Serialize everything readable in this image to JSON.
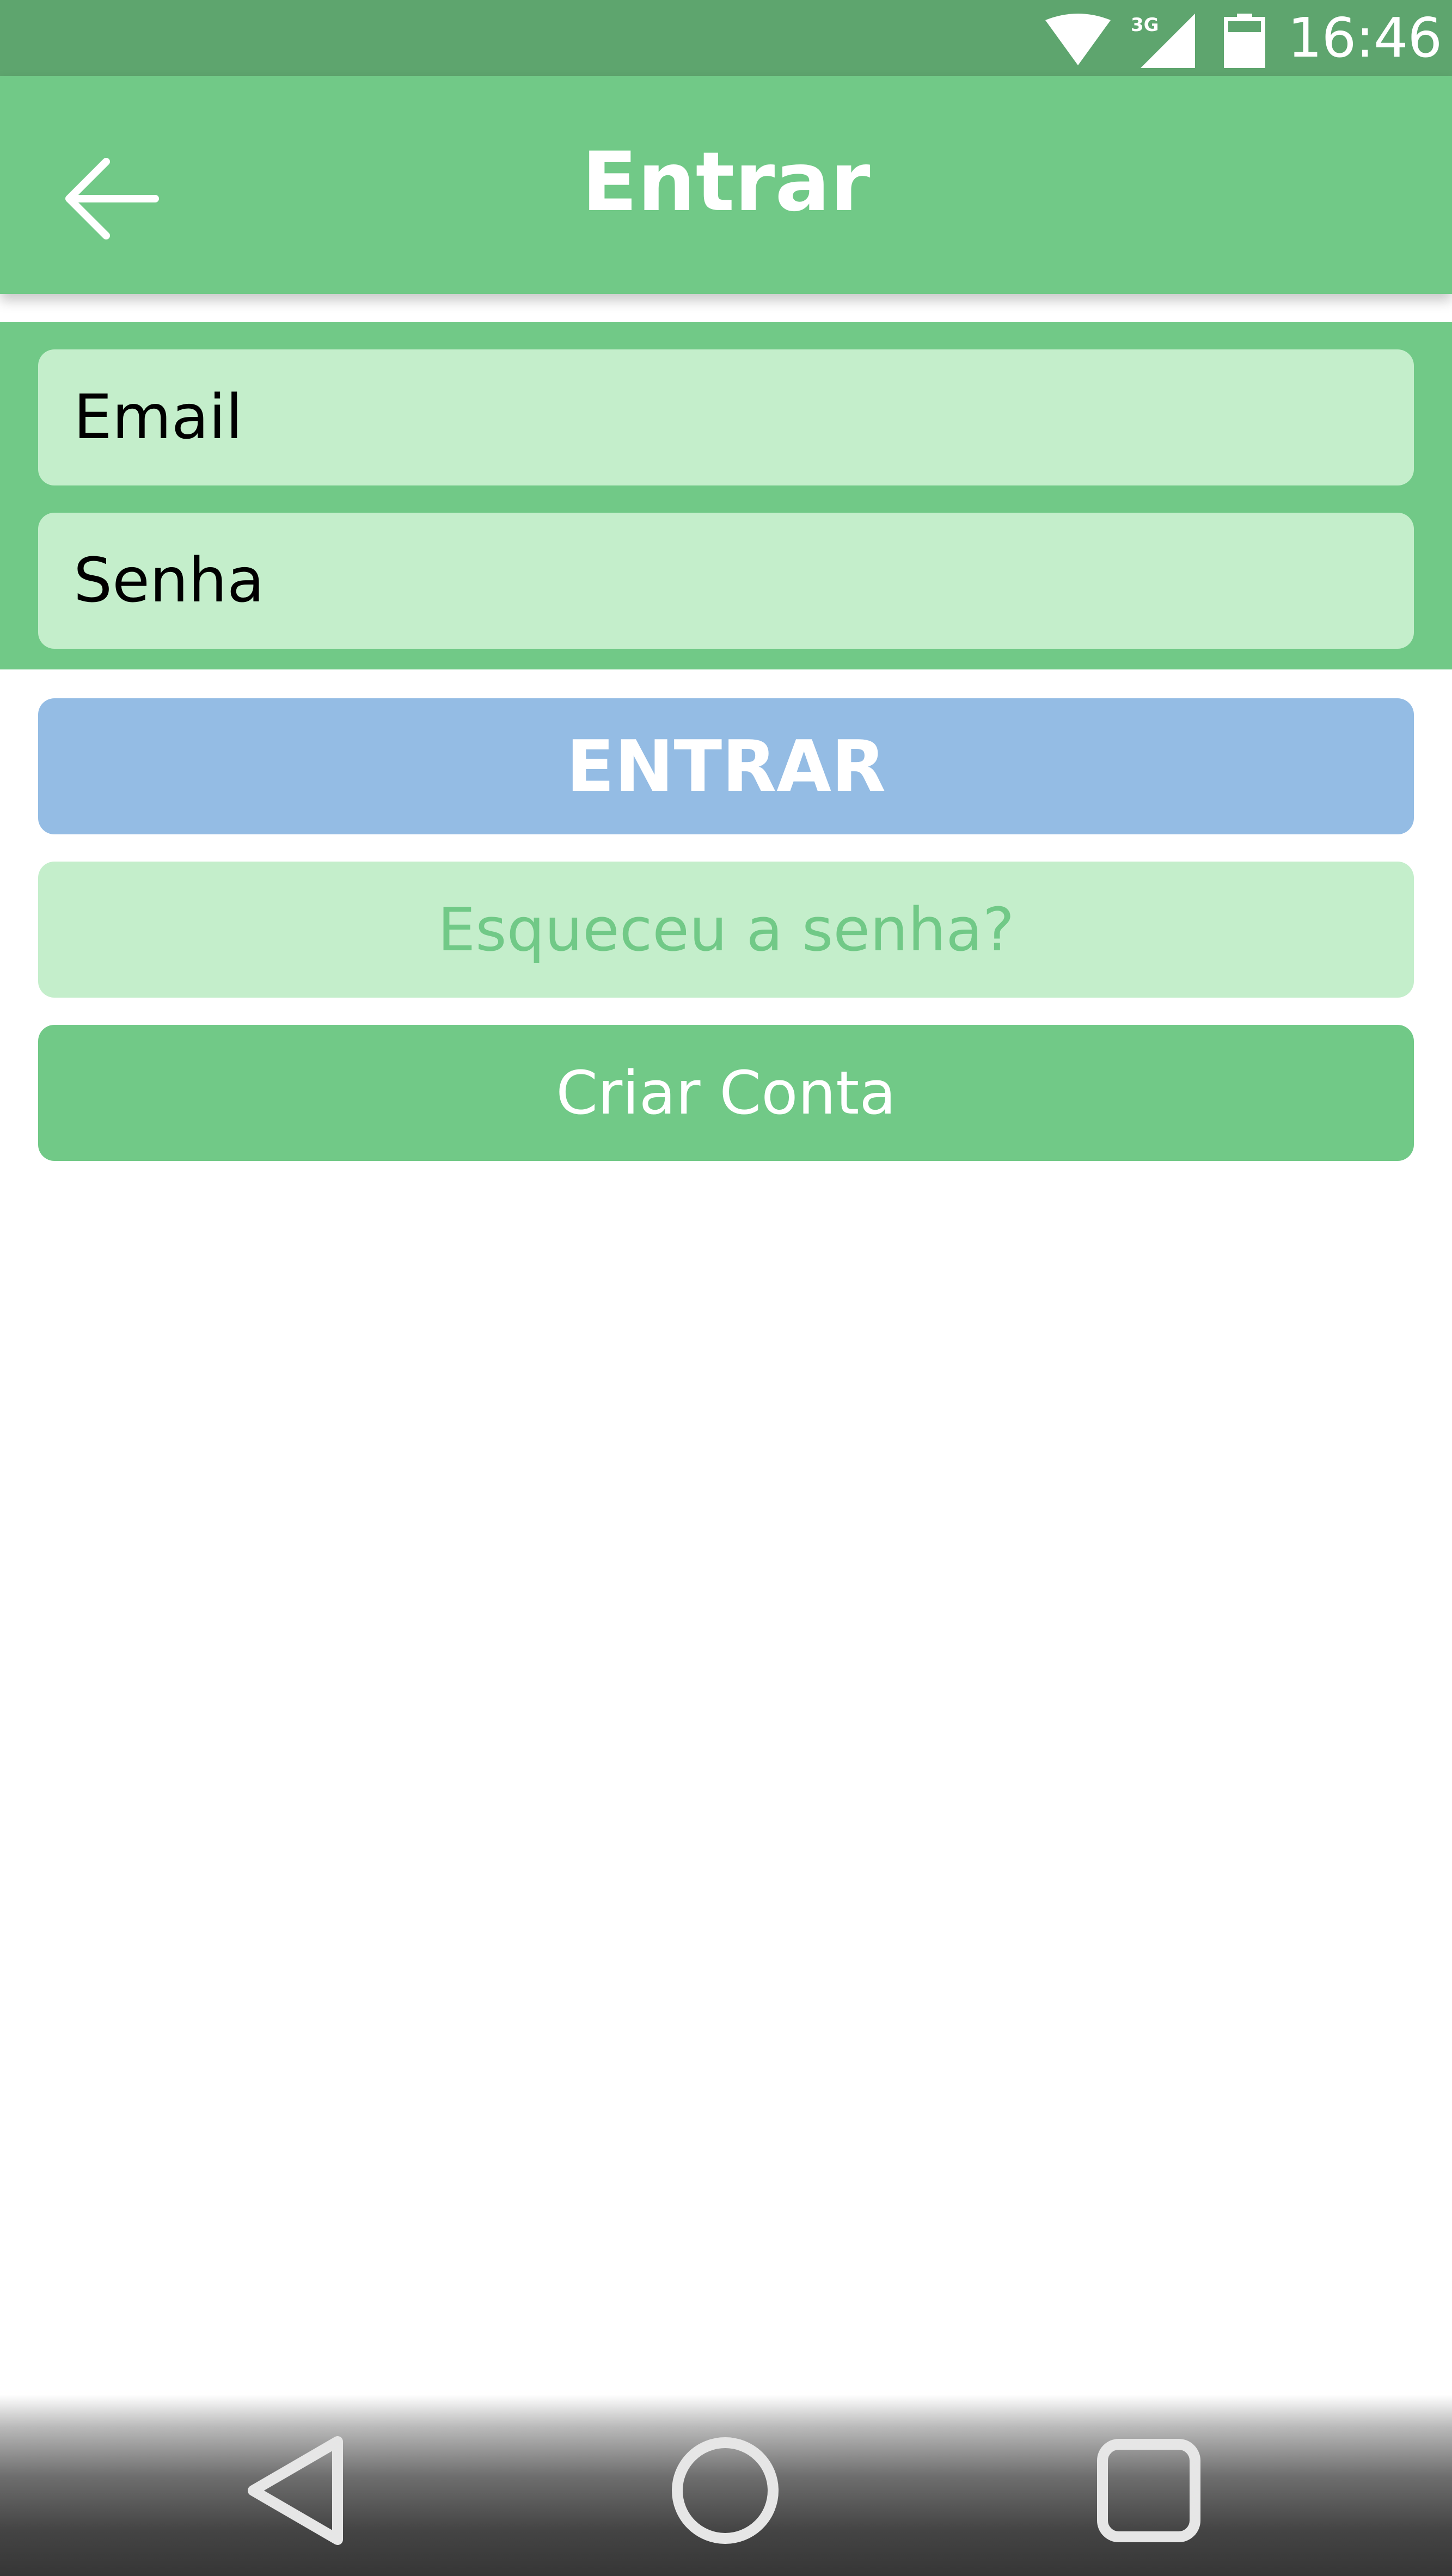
{
  "status_bar": {
    "network_label": "3G",
    "time": "16:46",
    "icons": [
      "wifi-icon",
      "cell-signal-icon",
      "battery-icon"
    ]
  },
  "app_bar": {
    "title": "Entrar",
    "back_icon": "arrow-left-icon"
  },
  "form": {
    "email_placeholder": "Email",
    "password_placeholder": "Senha"
  },
  "buttons": {
    "login_label": "ENTRAR",
    "forgot_label": "Esqueceu a senha?",
    "create_label": "Criar Conta"
  },
  "nav_bar": {
    "icons": [
      "back-triangle-icon",
      "home-circle-icon",
      "recents-square-icon"
    ]
  },
  "colors": {
    "status_bar": "#5ea56e",
    "primary_green": "#71c987",
    "light_green": "#c4eecb",
    "login_blue": "#94bce4",
    "white": "#ffffff"
  }
}
